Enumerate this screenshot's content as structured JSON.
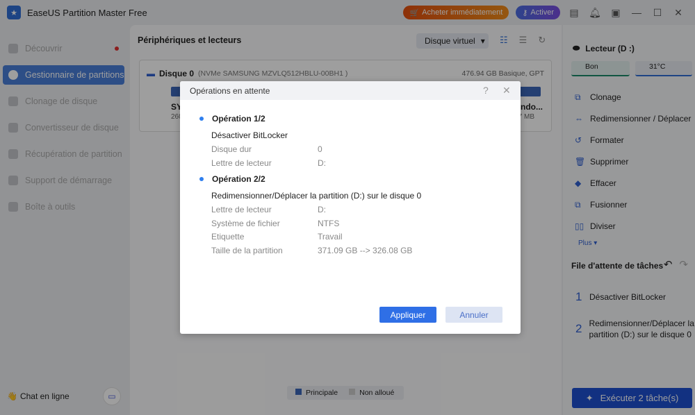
{
  "app": {
    "title": "EaseUS Partition Master Free",
    "buy_label": "Acheter immédiatement",
    "activate_label": "Activer"
  },
  "sidebar": {
    "items": [
      {
        "label": "Découvrir"
      },
      {
        "label": "Gestionnaire de partitions"
      },
      {
        "label": "Clonage de disque"
      },
      {
        "label": "Convertisseur de disque"
      },
      {
        "label": "Récupération de partition"
      },
      {
        "label": "Support de démarrage"
      },
      {
        "label": "Boîte à outils"
      }
    ],
    "chat_label": "Chat en ligne"
  },
  "main": {
    "title": "Périphériques et lecteurs",
    "virtual_disk": "Disque virtuel",
    "disk": {
      "name": "Disque 0",
      "model": "(NVMe SAMSUNG MZVLQ512HBLU-00BH1 )",
      "size": "476.94 GB Basique, GPT",
      "part1_label": "SY",
      "part1_size": "260",
      "part2_label": "indo...",
      "part2_size": "7 MB"
    },
    "legend": [
      {
        "label": "Principale",
        "color": "#3a66b8"
      },
      {
        "label": "Non alloué",
        "color": "#cccccc"
      }
    ]
  },
  "right": {
    "drive": "Lecteur (D :)",
    "health": "Bon",
    "temp": "31°C",
    "actions": [
      {
        "label": "Clonage",
        "icon": "clone-icon"
      },
      {
        "label": "Redimensionner / Déplacer",
        "icon": "resize-icon"
      },
      {
        "label": "Formater",
        "icon": "format-icon"
      },
      {
        "label": "Supprimer",
        "icon": "trash-icon"
      },
      {
        "label": "Effacer",
        "icon": "eraser-icon"
      },
      {
        "label": "Fusionner",
        "icon": "merge-icon"
      },
      {
        "label": "Diviser",
        "icon": "split-icon"
      }
    ],
    "more": "Plus",
    "queue_title": "File d'attente de tâches",
    "queue": [
      {
        "num": "1",
        "label": "Désactiver BitLocker"
      },
      {
        "num": "2",
        "label": "Redimensionner/Déplacer la partition (D:) sur le disque 0"
      }
    ],
    "execute": "Exécuter 2 tâche(s)"
  },
  "dialog": {
    "title": "Opérations en attente",
    "op1": {
      "title": "Opération 1/2",
      "desc": "Désactiver BitLocker",
      "rows": [
        {
          "k": "Disque dur",
          "v": "0"
        },
        {
          "k": "Lettre de lecteur",
          "v": "D:"
        }
      ]
    },
    "op2": {
      "title": "Opération 2/2",
      "desc": "Redimensionner/Déplacer la partition (D:) sur le disque 0",
      "rows": [
        {
          "k": "Lettre de lecteur",
          "v": "D:"
        },
        {
          "k": "Système de fichier",
          "v": "NTFS"
        },
        {
          "k": "Etiquette",
          "v": "Travail"
        },
        {
          "k": "Taille de la partition",
          "v": "371.09 GB --> 326.08 GB"
        }
      ]
    },
    "apply": "Appliquer",
    "cancel": "Annuler"
  }
}
